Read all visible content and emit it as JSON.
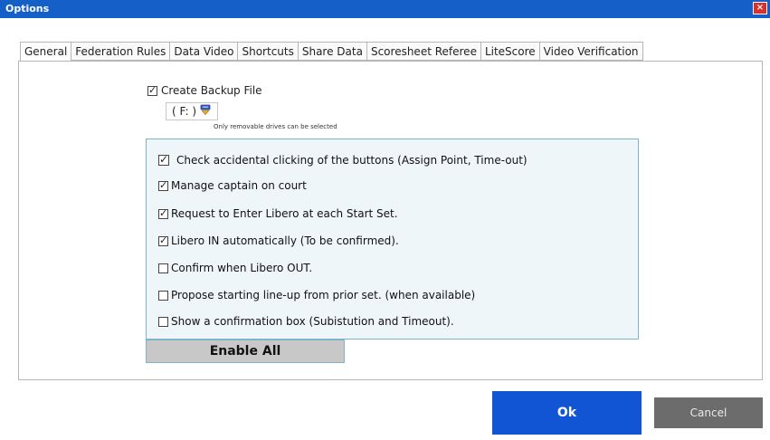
{
  "window": {
    "title": "Options",
    "close_label": "×"
  },
  "tabs": [
    {
      "label": "General",
      "active": true
    },
    {
      "label": "Federation Rules"
    },
    {
      "label": "Data Video"
    },
    {
      "label": "Shortcuts"
    },
    {
      "label": "Share Data"
    },
    {
      "label": "Scoresheet Referee"
    },
    {
      "label": "LiteScore"
    },
    {
      "label": "Video Verification"
    }
  ],
  "backup": {
    "label": "Create Backup File",
    "checked": true,
    "drive_value": "( F: )",
    "drive_icon": "removable-drive-icon",
    "note": "Only removable drives can be selected"
  },
  "options": [
    {
      "label": "Check accidental clicking of the buttons (Assign Point, Time-out)",
      "checked": true
    },
    {
      "label": "Manage captain on court",
      "checked": true
    },
    {
      "label": "Request to Enter Libero at each Start Set.",
      "checked": true
    },
    {
      "label": "Libero IN automatically (To be confirmed).",
      "checked": true
    },
    {
      "label": "Confirm when Libero OUT.",
      "checked": false
    },
    {
      "label": "Propose starting line-up from prior set. (when available)",
      "checked": false
    },
    {
      "label": "Show a confirmation box (Subistution and Timeout).",
      "checked": false
    }
  ],
  "buttons": {
    "enable_all": "Enable All",
    "ok": "Ok",
    "cancel": "Cancel"
  },
  "colors": {
    "titlebar": "#1560c8",
    "ok": "#1155d4",
    "cancel": "#6c6c6c",
    "options_bg": "#eff6fa",
    "options_border": "#7fb4cc"
  }
}
